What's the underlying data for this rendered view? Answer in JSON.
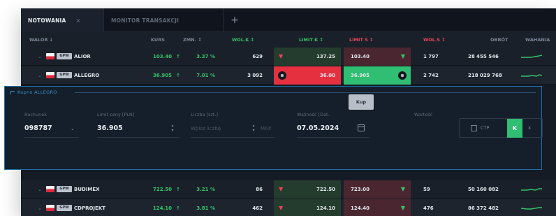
{
  "tabs": [
    {
      "label": "NOTOWANIA",
      "active": true
    },
    {
      "label": "MONITOR TRANSAKCJI",
      "active": false
    }
  ],
  "tab_close": "×",
  "add_tab": "+",
  "columns": {
    "walor": "WALOR ↓",
    "kurs": "KURS",
    "zmn": "ZMN. ↕",
    "wolk": "WOL.K ↕",
    "limitk": "LIMIT K ↕",
    "limits": "LIMIT S ↕",
    "wols": "WOL.S ↕",
    "obrot": "OBRÓT",
    "wakanie": "WAHANIA"
  },
  "rows_top": [
    {
      "chevron": "⌄",
      "badge": "GPW",
      "name": "ALIOR",
      "kurs": "103.40",
      "arrow": "↑",
      "zmn": "3.37 %",
      "wolk": "629",
      "limitk_icon": "▼",
      "limitk": "137.25",
      "limits": "103.40",
      "limits_icon": "▼",
      "wols": "1 797",
      "obrot": "28 455 546",
      "highlight": false
    },
    {
      "chevron": "⌄",
      "badge": "GPW",
      "name": "ALLEGRO",
      "kurs": "36.905",
      "arrow": "↑",
      "zmn": "7.01 %",
      "wolk": "3 092",
      "limitk_icon": "⊗",
      "limitk": "36.00",
      "limits": "36.905",
      "limits_icon": "⊗",
      "wols": "2 742",
      "obrot": "218 029 768",
      "highlight": true
    }
  ],
  "order_panel": {
    "title": "Kupno ALLEGRO",
    "tooltip": "Kup",
    "fields": {
      "rachunek_label": "Rachunek",
      "rachunek_value": "098787",
      "limit_label": "Limit ceny [PLN]",
      "limit_value": "36.905",
      "liczba_label": "Liczba [szt.]",
      "liczba_placeholder": "Wpisz liczbę",
      "max_label": "MAX",
      "waznosc_label": "Ważność [Dat..",
      "waznosc_value": "07.05.2024",
      "wartosc_label": "Wartość"
    },
    "ctp_label": "CTP",
    "submit_label": "K",
    "close_label": "x"
  },
  "rows_bottom": [
    {
      "chevron": "⌄",
      "badge": "GPW",
      "name": "BUDIMEX",
      "kurs": "722.50",
      "arrow": "↑",
      "zmn": "3.21 %",
      "wolk": "86",
      "limitk_icon": "▼",
      "limitk": "722.50",
      "limits": "723.00",
      "limits_icon": "▼",
      "wols": "59",
      "obrot": "50 160 082",
      "highlight": false
    },
    {
      "chevron": "⌄",
      "badge": "GPW",
      "name": "CDPROJEKT",
      "kurs": "124.10",
      "arrow": "↑",
      "zmn": "3.81 %",
      "wolk": "462",
      "limitk_icon": "▼",
      "limitk": "124.10",
      "limits": "124.40",
      "limits_icon": "▼",
      "wols": "476",
      "obrot": "86 372 482",
      "highlight": false
    }
  ],
  "colors": {
    "accent_green": "#35c46b",
    "accent_red": "#e8455a",
    "panel_border": "#1e6fa7"
  },
  "icons": [
    "plus-icon",
    "close-icon",
    "chevron-down-icon",
    "sort-icon",
    "arrow-up-icon",
    "sell-marker-icon",
    "cancel-order-icon",
    "calendar-icon",
    "stepper-icon",
    "checkbox-icon",
    "sparkline-icon"
  ]
}
